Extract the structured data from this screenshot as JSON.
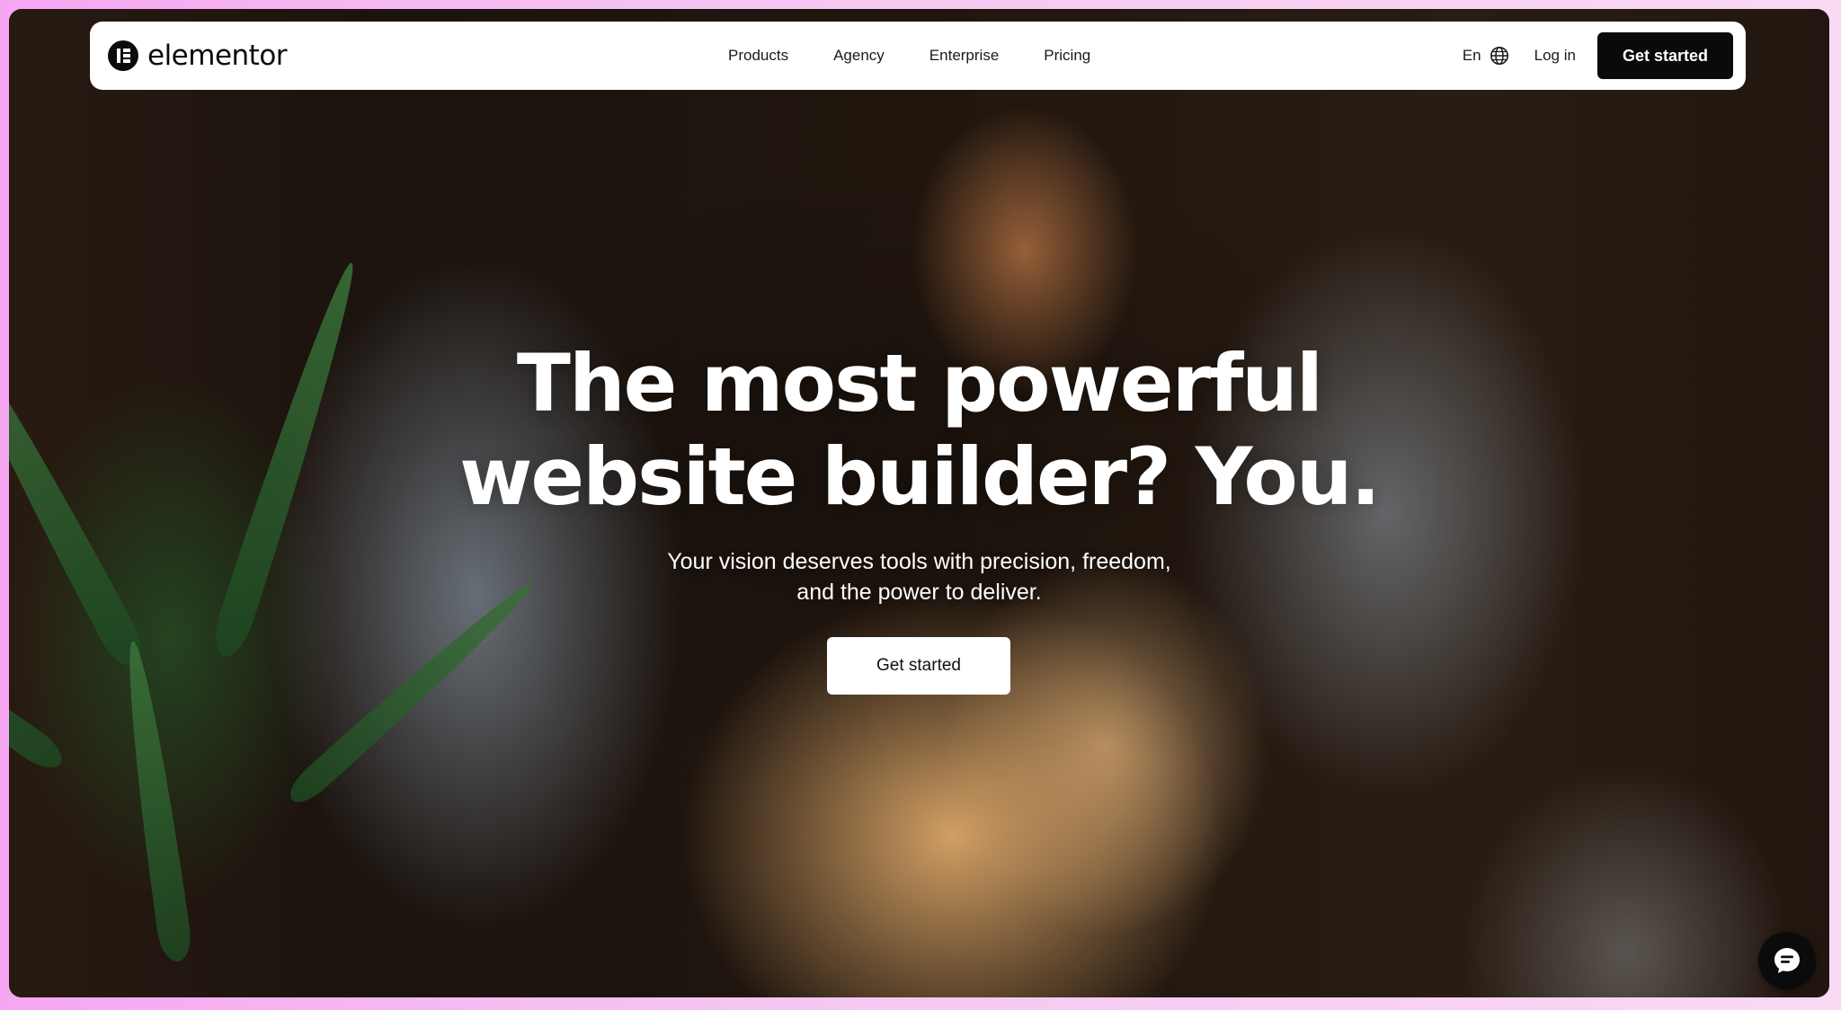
{
  "brand": {
    "name": "elementor",
    "logo_icon": "elementor-logo-icon"
  },
  "nav": {
    "links": [
      {
        "label": "Products"
      },
      {
        "label": "Agency"
      },
      {
        "label": "Enterprise"
      },
      {
        "label": "Pricing"
      }
    ],
    "language": "En",
    "language_icon": "globe-icon",
    "login_label": "Log in",
    "cta_label": "Get started"
  },
  "hero": {
    "headline_line1": "The most powerful",
    "headline_line2": "website builder? You.",
    "subhead_line1": "Your vision deserves tools with precision, freedom,",
    "subhead_line2": "and the power to deliver.",
    "cta_label": "Get started"
  },
  "chat": {
    "icon": "chat-icon"
  },
  "colors": {
    "nav_cta_bg": "#0a0a0a",
    "hero_cta_bg": "#ffffff",
    "page_border": "#f6a7f2"
  }
}
